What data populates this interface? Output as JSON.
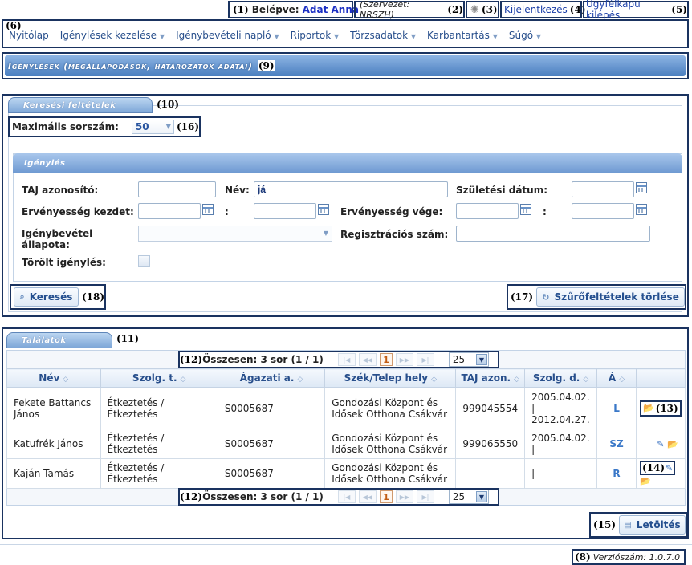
{
  "topbar": {
    "n1": "(1)",
    "logged_label": "Belépve:",
    "user": "Adat Anna",
    "org": "(Szervezet: NRSZH)",
    "n2": "(2)",
    "n3": "(3)",
    "logout": "Kijelentkezés",
    "n4": "(4)",
    "portal_exit": "Ügyfélkapu kilépés",
    "n5": "(5)"
  },
  "nav": {
    "n6": "(6)",
    "items": [
      "Nyitólap",
      "Igénylések kezelése",
      "Igénybevételi napló",
      "Riportok",
      "Törzsadatok",
      "Karbantartás",
      "Súgó"
    ]
  },
  "page": {
    "title": "Igénylések (megállapodások, határozatok adatai)",
    "n9": "(9)"
  },
  "search": {
    "tab": "Keresési feltételek",
    "n10": "(10)",
    "max_label": "Maximális sorszám:",
    "max_value": "50",
    "n16": "(16)",
    "sub_tab": "Igénylés",
    "taj_label": "TAJ azonosító:",
    "taj_value": "",
    "name_label": "Név:",
    "name_value": "já",
    "birth_label": "Születési dátum:",
    "valid_from_label": "Ervényesség kezdet:",
    "colon": ":",
    "valid_to_label": "Ervényesség vége:",
    "status_label": "Igénybevétel állapota:",
    "status_value": "-",
    "reg_label": "Regisztrációs szám:",
    "deleted_label": "Törölt igénylés:",
    "search_btn": "Keresés",
    "n18": "(18)",
    "clear_btn": "Szűrőfeltételek törlése",
    "n17": "(17)"
  },
  "results": {
    "tab": "Találatok",
    "n11": "(11)",
    "pager": {
      "n12": "(12)",
      "summary": "Összesen: 3 sor (1 / 1)",
      "page": "1",
      "size": "25"
    },
    "columns": [
      "Név",
      "Szolg. t.",
      "Ágazati a.",
      "Szék/Telep hely",
      "TAJ azon.",
      "Szolg. d.",
      "Á"
    ],
    "rows": [
      {
        "name": "Fekete Battancs János",
        "service": "Étkeztetés / Étkeztetés",
        "code": "S0005687",
        "place": "Gondozási Központ és Idősek Otthona Csákvár",
        "taj": "999045554",
        "dates": "2005.04.02. | 2012.04.27.",
        "status": "L"
      },
      {
        "name": "Katufrék János",
        "service": "Étkeztetés / Étkeztetés",
        "code": "S0005687",
        "place": "Gondozási Központ és Idősek Otthona Csákvár",
        "taj": "999065550",
        "dates": "2005.04.02. |",
        "status": "SZ"
      },
      {
        "name": "Kaján Tamás",
        "service": "Étkeztetés / Étkeztetés",
        "code": "S0005687",
        "place": "Gondozási Központ és Idősek Otthona Csákvár",
        "taj": "",
        "dates": "|",
        "status": "R"
      }
    ],
    "n13": "(13)",
    "n14": "(14)",
    "download": "Letöltés",
    "n15": "(15)"
  },
  "footer": {
    "n8": "(8)",
    "version": "Verziószám: 1.0.7.0"
  }
}
